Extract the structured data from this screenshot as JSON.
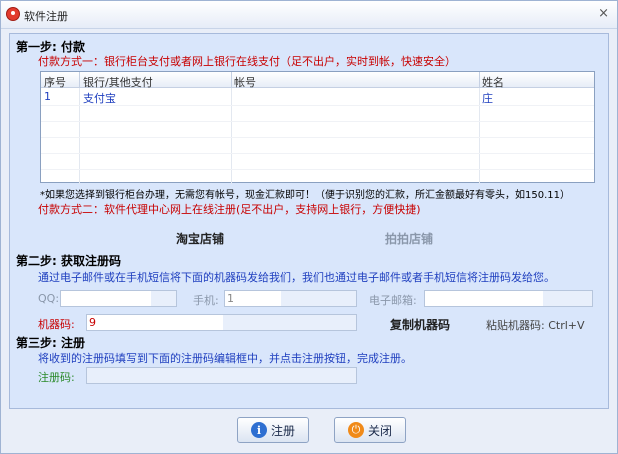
{
  "window": {
    "title": "软件注册",
    "close_glyph": "×"
  },
  "step1": {
    "title": "第一步: 付款",
    "method1": "付款方式一：银行柜台支付或者网上银行在线支付（足不出户，实时到帐，快速安全）",
    "table": {
      "headers": [
        "序号",
        "银行/其他支付",
        "帐号",
        "姓名"
      ],
      "rows": [
        {
          "no": "1",
          "bank": "支付宝",
          "account": "",
          "name": "庄"
        }
      ]
    },
    "note": "*如果您选择到银行柜台办理，无需您有帐号，现金汇款即可！（便于识别您的汇款，所汇金额最好有零头，如150.11）",
    "method2": "付款方式二：软件代理中心网上在线注册(足不出户，支持网上银行，方便快捷)",
    "taobao": "淘宝店铺",
    "paipai": "拍拍店铺"
  },
  "step2": {
    "title": "第二步: 获取注册码",
    "desc": "通过电子邮件或在手机短信将下面的机器码发给我们，我们也通过电子邮件或者手机短信将注册码发给您。",
    "qq_label": "QQ:",
    "phone_label": "手机:",
    "phone_value": "1",
    "email_label": "电子邮箱:",
    "machine_label": "机器码:",
    "machine_value": "9",
    "copy_label": "复制机器码",
    "paste_hint": "粘贴机器码: Ctrl+V"
  },
  "step3": {
    "title": "第三步: 注册",
    "desc": "将收到的注册码填写到下面的注册码编辑框中，并点击注册按钮，完成注册。",
    "reg_label": "注册码:"
  },
  "buttons": {
    "register": "注册",
    "register_icon": "i",
    "close": "关闭",
    "close_icon": "⏻"
  }
}
